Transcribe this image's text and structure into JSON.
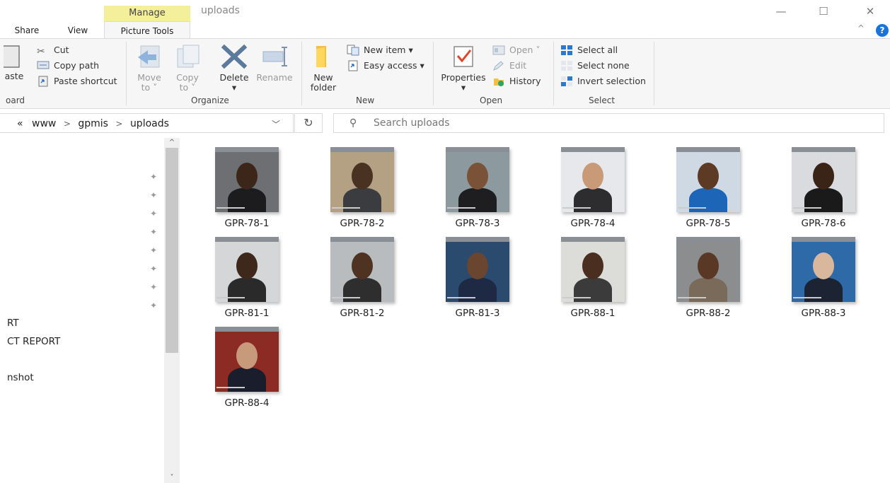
{
  "window": {
    "context_tab": "Manage",
    "title": "uploads",
    "minimize": "—",
    "maximize": "☐",
    "close": "✕"
  },
  "ribbon_tabs": {
    "share": "Share",
    "view": "View",
    "picture_tools": "Picture Tools",
    "collapse": "^",
    "help": "?"
  },
  "ribbon": {
    "clipboard": {
      "paste": "aste",
      "cut": "Cut",
      "copy_path": "Copy path",
      "paste_shortcut": "Paste shortcut",
      "label": "oard"
    },
    "organize": {
      "move_to": "Move",
      "move_to_2": "to ˅",
      "copy_to": "Copy",
      "copy_to_2": "to ˅",
      "delete": "Delete",
      "delete_caret": "▾",
      "rename": "Rename",
      "label": "Organize"
    },
    "new": {
      "new_folder": "New",
      "new_folder_2": "folder",
      "new_item": "New item ▾",
      "easy_access": "Easy access ▾",
      "label": "New"
    },
    "open": {
      "properties": "Properties",
      "properties_caret": "▾",
      "open": "Open ˅",
      "edit": "Edit",
      "history": "History",
      "label": "Open"
    },
    "select": {
      "select_all": "Select all",
      "select_none": "Select none",
      "invert_selection": "Invert selection",
      "label": "Select"
    }
  },
  "address": {
    "prefix": "«",
    "crumbs": [
      "www",
      "gpmis",
      "uploads"
    ],
    "separator": ">",
    "dropdown": "﹀",
    "refresh": "↻"
  },
  "search": {
    "placeholder": "Search uploads"
  },
  "nav": {
    "pin": "✦",
    "items": [
      "RT",
      "CT REPORT",
      "nshot"
    ],
    "scroll_up": "^",
    "scroll_down": "˅"
  },
  "files": [
    {
      "name": "GPR-78-1",
      "bg": "#6d6f73",
      "skin": "#3b2619",
      "shirt": "#1c1c1e"
    },
    {
      "name": "GPR-78-2",
      "bg": "#b4a083",
      "skin": "#4a3223",
      "shirt": "#3a3c40"
    },
    {
      "name": "GPR-78-3",
      "bg": "#8c9aa0",
      "skin": "#7a5238",
      "shirt": "#1e1e20"
    },
    {
      "name": "GPR-78-4",
      "bg": "#e6e8ec",
      "skin": "#c89a78",
      "shirt": "#2d2d30"
    },
    {
      "name": "GPR-78-5",
      "bg": "#cfd9e4",
      "skin": "#5c3a24",
      "shirt": "#1d66b7"
    },
    {
      "name": "GPR-78-6",
      "bg": "#d9dbde",
      "skin": "#3a2418",
      "shirt": "#1a1a1a"
    },
    {
      "name": "GPR-81-1",
      "bg": "#d4d6d8",
      "skin": "#3e281c",
      "shirt": "#2a2a2a"
    },
    {
      "name": "GPR-81-2",
      "bg": "#b9bcbf",
      "skin": "#4f3322",
      "shirt": "#2e2e2e"
    },
    {
      "name": "GPR-81-3",
      "bg": "#2a4a6e",
      "skin": "#6a4530",
      "shirt": "#1e2a44"
    },
    {
      "name": "GPR-88-1",
      "bg": "#dcdcd8",
      "skin": "#4a2f20",
      "shirt": "#3b3b3b"
    },
    {
      "name": "GPR-88-2",
      "bg": "#8c8d8f",
      "skin": "#5a3826",
      "shirt": "#7a6a5a"
    },
    {
      "name": "GPR-88-3",
      "bg": "#2f6aa8",
      "skin": "#d9b79c",
      "shirt": "#1c2433"
    },
    {
      "name": "GPR-88-4",
      "bg": "#8c2a24",
      "skin": "#c79a7c",
      "shirt": "#1a1e2c"
    }
  ]
}
